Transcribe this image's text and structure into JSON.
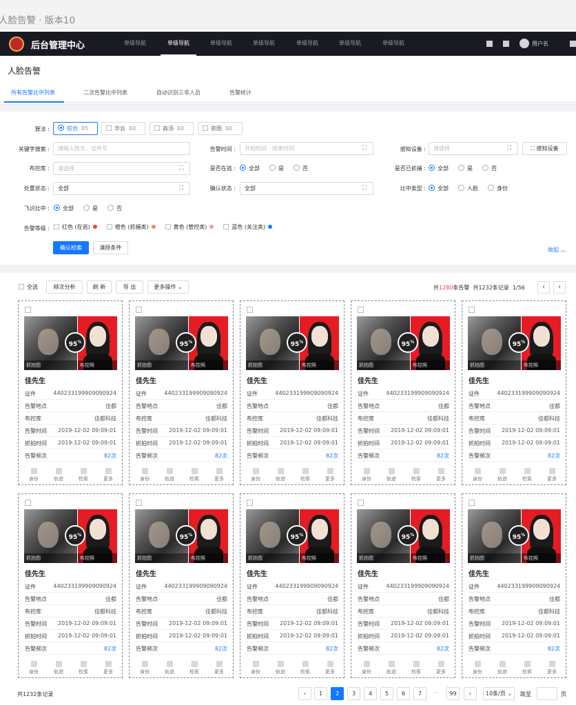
{
  "window_title": "人脸告警 · 版本10",
  "nav": {
    "brand": "后台管理中心",
    "items": [
      "单级导航",
      "单级导航",
      "单级导航",
      "单级导航",
      "单级导航",
      "单级导航",
      "单级导航"
    ],
    "user": "用户名"
  },
  "page_title": "人脸告警",
  "tabs": [
    "所有告警比中列表",
    "二次告警比中列表",
    "自动识别三非人员",
    "告警统计"
  ],
  "filters": {
    "algorithm_label": "算法 :",
    "algorithms": [
      {
        "name": "综合",
        "count": "85"
      },
      {
        "name": "华云",
        "count": "60"
      },
      {
        "name": "商汤",
        "count": "60"
      },
      {
        "name": "依图",
        "count": "60"
      }
    ],
    "keyword_label": "关键字搜索 :",
    "keyword_placeholder": "请输入姓名、证件号",
    "alarm_time_label": "告警时间 :",
    "alarm_time_placeholder": "开始时间 - 结束时间",
    "device_label": "感知设备 :",
    "device_placeholder": "请选择",
    "device_button": "感知设备",
    "control_lib_label": "布控库 :",
    "control_lib_placeholder": "请选择",
    "in_custody_label": "是否在逃 :",
    "in_custody_options": [
      "全部",
      "是",
      "否"
    ],
    "captured_label": "是否已抓捕 :",
    "captured_options": [
      "全部",
      "是",
      "否"
    ],
    "handle_status_label": "处置状态 :",
    "handle_status_value": "全部",
    "confirm_status_label": "确认状态 :",
    "confirm_status_value": "全部",
    "match_type_label": "比中类型 :",
    "match_type_options": [
      "全部",
      "人脸",
      "身份"
    ],
    "flight_label": "飞识比中 :",
    "flight_options": [
      "全部",
      "是",
      "否"
    ],
    "level_label": "告警等级 :",
    "levels": [
      {
        "name": "红色 (在逃)",
        "color": "#e8453c"
      },
      {
        "name": "橙色 (抓捕类)",
        "color": "#f08a5d"
      },
      {
        "name": "黄色 (管控类)",
        "color": "#e9a19a"
      },
      {
        "name": "蓝色 (关注类)",
        "color": "#1677ff"
      }
    ],
    "search_button": "确认检索",
    "clear_button": "清除条件",
    "collapse": "收起 ︿"
  },
  "toolbar": {
    "select_all": "全选",
    "buttons": [
      "频次分析",
      "刷 新",
      "导 出",
      "更多操作 ⌄"
    ],
    "summary_prefix": "共",
    "summary_alarms": "1280",
    "summary_mid": "条告警",
    "summary_records": "共1232条记录",
    "page_info": "1/56"
  },
  "card": {
    "score": "95",
    "score_unit": "%",
    "capture_caption": "抓拍图",
    "control_caption": "布控照",
    "name": "佳先生",
    "fields": [
      {
        "k": "证件",
        "v": "440233199909090924"
      },
      {
        "k": "告警地点",
        "v": "佳都"
      },
      {
        "k": "布控库",
        "v": "佳都科技"
      },
      {
        "k": "告警时间",
        "v": "2019-12-02   09:09:01"
      },
      {
        "k": "抓拍时间",
        "v": "2019-12-02   09:09:01"
      },
      {
        "k": "告警频次",
        "v": "82次"
      }
    ],
    "actions": [
      "身份",
      "轨迹",
      "检索",
      "更多"
    ]
  },
  "pagination": {
    "total": "共1232条记录",
    "pages": [
      "1",
      "2",
      "3",
      "4",
      "5",
      "6",
      "7",
      "···",
      "99"
    ],
    "active_page": "2",
    "page_size": "10条/页 ⌄",
    "goto": "跳至",
    "unit": "页"
  }
}
